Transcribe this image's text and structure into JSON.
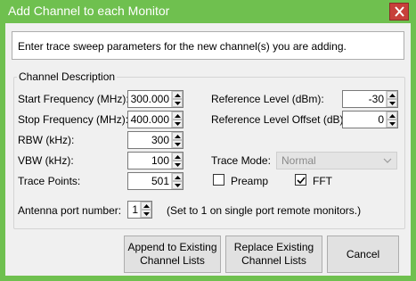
{
  "window": {
    "title": "Add Channel to each Monitor"
  },
  "info": {
    "text": "Enter trace sweep parameters for the new channel(s) you are adding."
  },
  "group": {
    "label": "Channel Description"
  },
  "fields": {
    "start_freq": {
      "label": "Start Frequency (MHz):",
      "value": "300.000"
    },
    "stop_freq": {
      "label": "Stop Frequency (MHz):",
      "value": "400.000"
    },
    "rbw": {
      "label": "RBW (kHz):",
      "value": "300"
    },
    "vbw": {
      "label": "VBW (kHz):",
      "value": "100"
    },
    "trace_points": {
      "label": "Trace Points:",
      "value": "501"
    },
    "ref_level": {
      "label": "Reference Level (dBm):",
      "value": "-30"
    },
    "ref_offset": {
      "label": "Reference Level Offset (dB):",
      "value": "0"
    },
    "antenna_port": {
      "label": "Antenna port number:",
      "value": "1",
      "note": "(Set to 1 on single port remote monitors.)"
    }
  },
  "trace_mode": {
    "label": "Trace Mode:",
    "selected": "Normal"
  },
  "checkboxes": {
    "preamp": {
      "label": "Preamp",
      "checked": false
    },
    "fft": {
      "label": "FFT",
      "checked": true
    }
  },
  "buttons": {
    "append": "Append to Existing Channel Lists",
    "replace": "Replace Existing Channel Lists",
    "cancel": "Cancel"
  },
  "colors": {
    "titlebar": "#6fc04f",
    "close": "#c7403a"
  }
}
